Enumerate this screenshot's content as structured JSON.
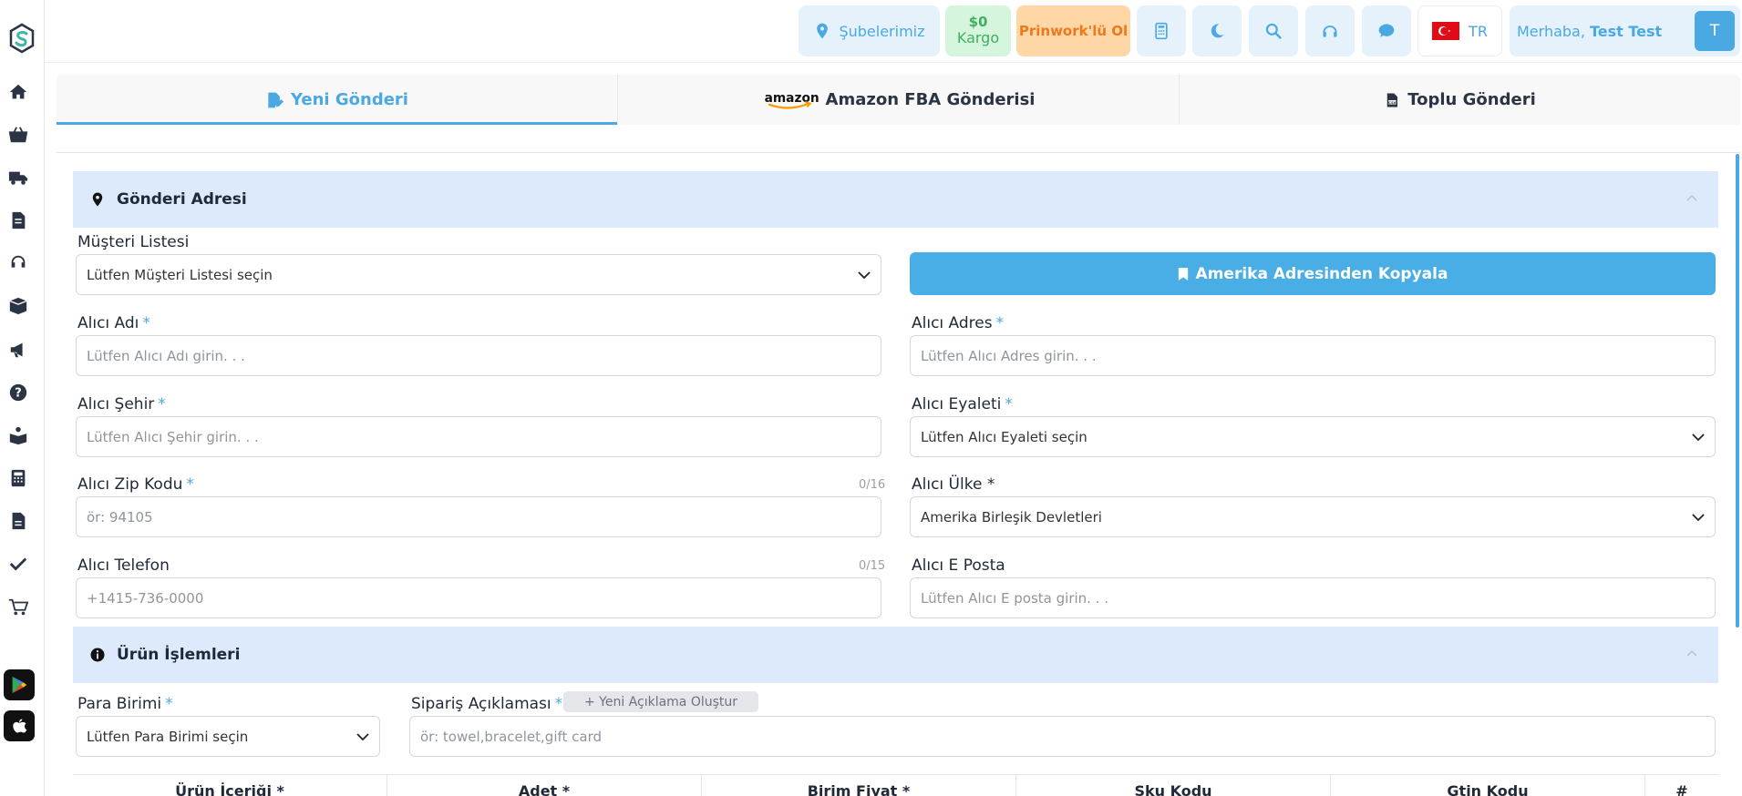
{
  "sidebar": {
    "items": [
      "home-icon",
      "basket-icon",
      "truck-icon",
      "document-icon",
      "headset-icon",
      "boxes-icon",
      "megaphone-icon",
      "question-icon",
      "reader-icon",
      "calculator-icon",
      "file-icon",
      "check-icon",
      "cart-icon"
    ],
    "stores": [
      "google-play-icon",
      "apple-icon"
    ]
  },
  "topbar": {
    "branches_label": "Şubelerimiz",
    "cargo_amount": "$0",
    "cargo_label": "Kargo",
    "prinwork_label": "Prinwork'lü Ol",
    "lang_label": "TR",
    "greeting": "Merhaba,",
    "user_name": "Test Test",
    "avatar_initial": "T"
  },
  "tabs": [
    {
      "label": "Yeni Gönderi",
      "active": true
    },
    {
      "label": "Amazon FBA Gönderisi",
      "active": false,
      "brand": "amazon"
    },
    {
      "label": "Toplu Gönderi",
      "active": false
    }
  ],
  "address": {
    "title": "Gönderi Adresi",
    "customer_list_label": "Müşteri Listesi",
    "customer_list_placeholder": "Lütfen Müşteri Listesi seçin",
    "copy_button": "Amerika Adresinden Kopyala",
    "name_label": "Alıcı Adı",
    "name_placeholder": "Lütfen Alıcı Adı girin. . .",
    "address_label": "Alıcı Adres",
    "address_placeholder": "Lütfen Alıcı Adres girin. . .",
    "city_label": "Alıcı Şehir",
    "city_placeholder": "Lütfen Alıcı Şehir girin. . .",
    "state_label": "Alıcı Eyaleti",
    "state_placeholder": "Lütfen Alıcı Eyaleti seçin",
    "zip_label": "Alıcı Zip Kodu",
    "zip_counter": "0/16",
    "zip_placeholder": "ör: 94105",
    "country_label": "Alıcı Ülke *",
    "country_value": "Amerika Birleşik Devletleri",
    "phone_label": "Alıcı Telefon",
    "phone_counter": "0/15",
    "phone_placeholder": "+1415-736-0000",
    "email_label": "Alıcı E Posta",
    "email_placeholder": "Lütfen Alıcı E posta girin. . .",
    "required_mark": "*"
  },
  "products": {
    "title": "Ürün İşlemleri",
    "currency_label": "Para Birimi",
    "currency_placeholder": "Lütfen Para Birimi seçin",
    "order_desc_label": "Sipariş Açıklaması",
    "new_desc_button": "+ Yeni Açıklama Oluştur",
    "order_desc_placeholder": "ör: towel,bracelet,gift card",
    "columns": [
      "Ürün İçeriği *",
      "Adet *",
      "Birim Fiyat *",
      "Sku Kodu",
      "Gtin Kodu",
      "#"
    ]
  },
  "colors": {
    "accent": "#4aa8e3",
    "section_bg": "#dceafc",
    "prinwork_bg": "#ffd6a6",
    "cargo_bg": "#d6f5dd"
  }
}
